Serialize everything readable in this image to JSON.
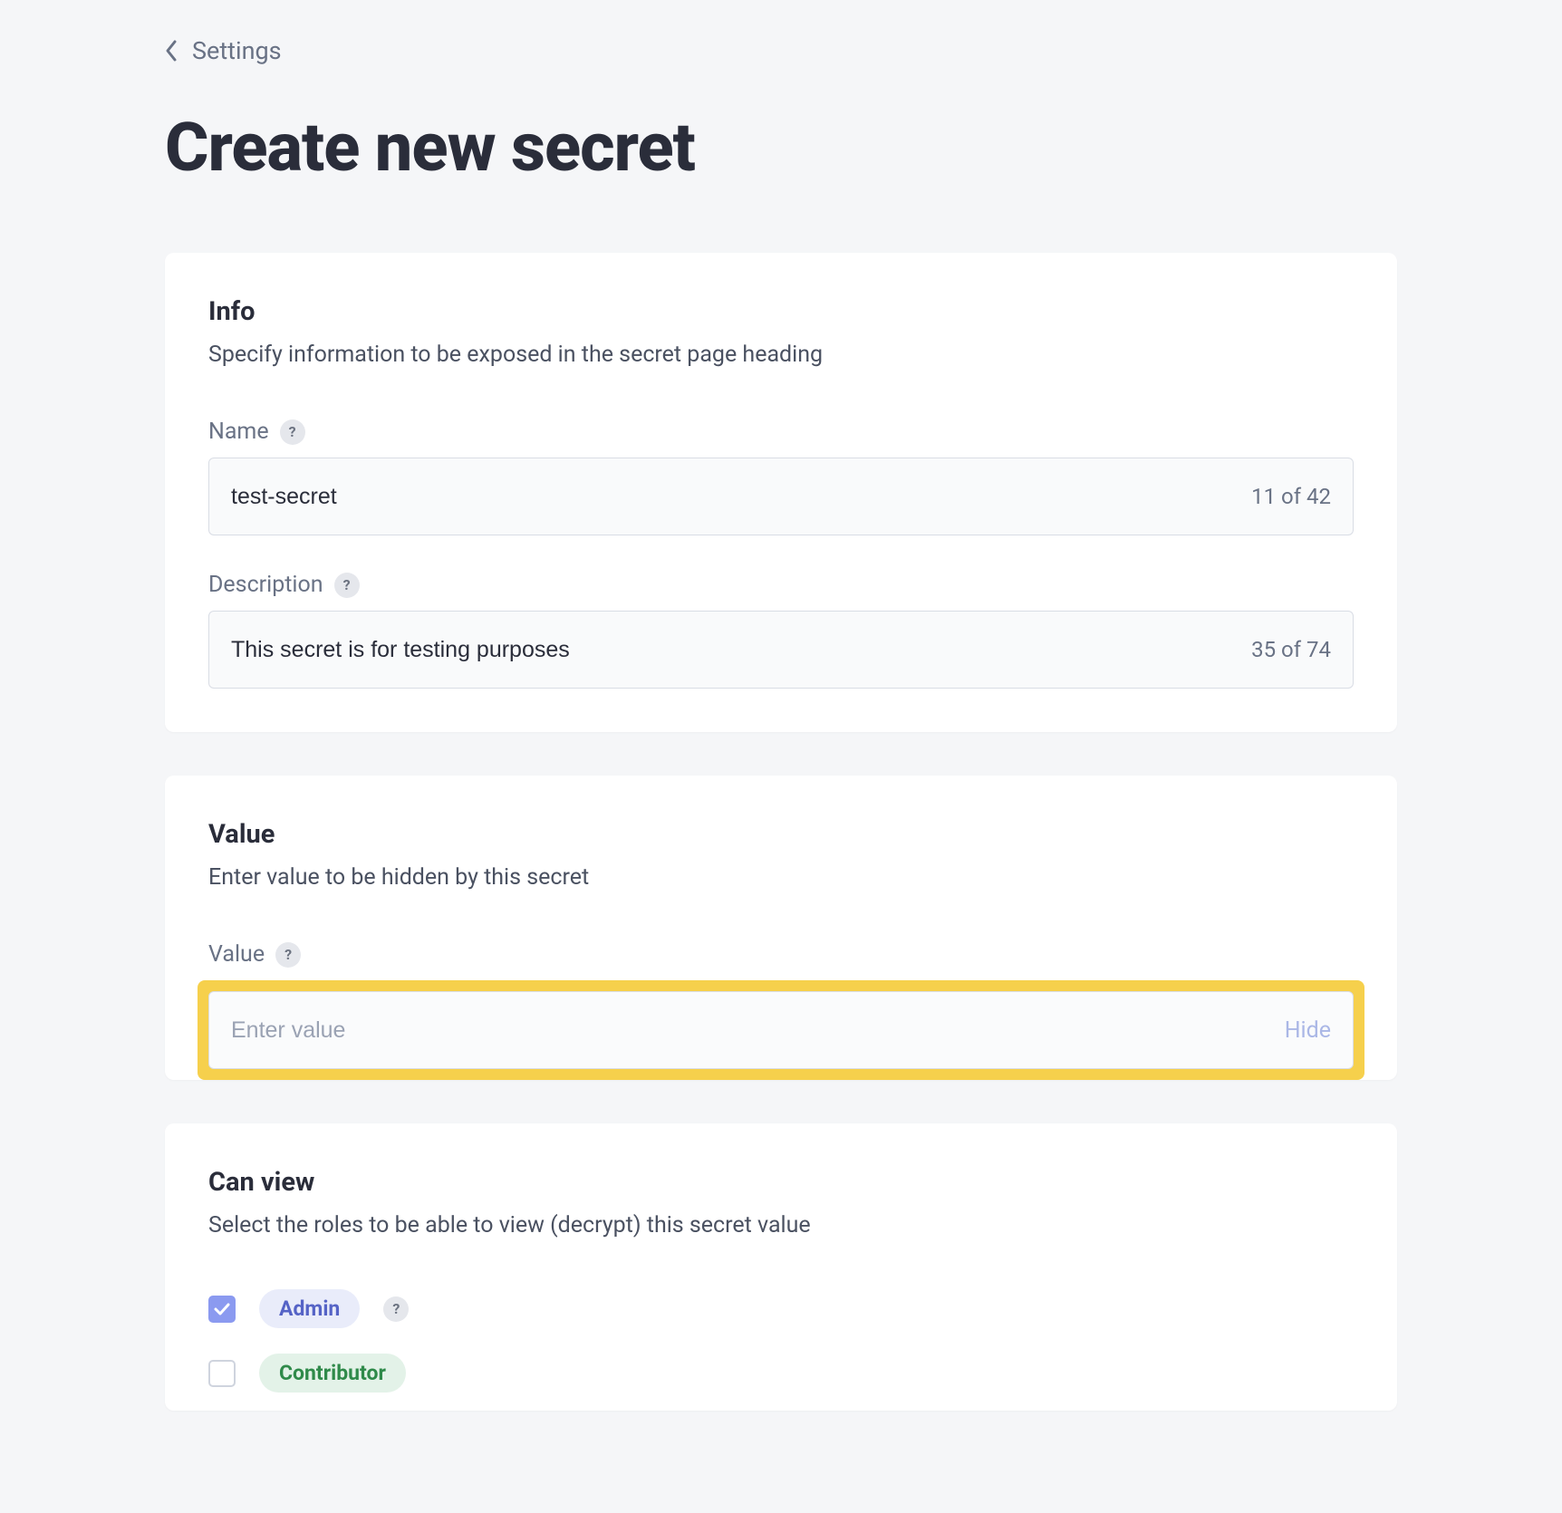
{
  "breadcrumb": {
    "label": "Settings"
  },
  "page": {
    "title": "Create new secret"
  },
  "info": {
    "title": "Info",
    "desc": "Specify information to be exposed in the secret page heading",
    "name": {
      "label": "Name",
      "value": "test-secret",
      "counter": "11 of 42"
    },
    "description": {
      "label": "Description",
      "value": "This secret is for testing purposes",
      "counter": "35 of 74"
    }
  },
  "value": {
    "title": "Value",
    "desc": "Enter value to be hidden by this secret",
    "field": {
      "label": "Value",
      "placeholder": "Enter value",
      "value": "",
      "hide_label": "Hide"
    }
  },
  "can_view": {
    "title": "Can view",
    "desc": "Select the roles to be able to view (decrypt) this secret value",
    "roles": [
      {
        "label": "Admin",
        "checked": true
      },
      {
        "label": "Contributor",
        "checked": false
      }
    ]
  }
}
